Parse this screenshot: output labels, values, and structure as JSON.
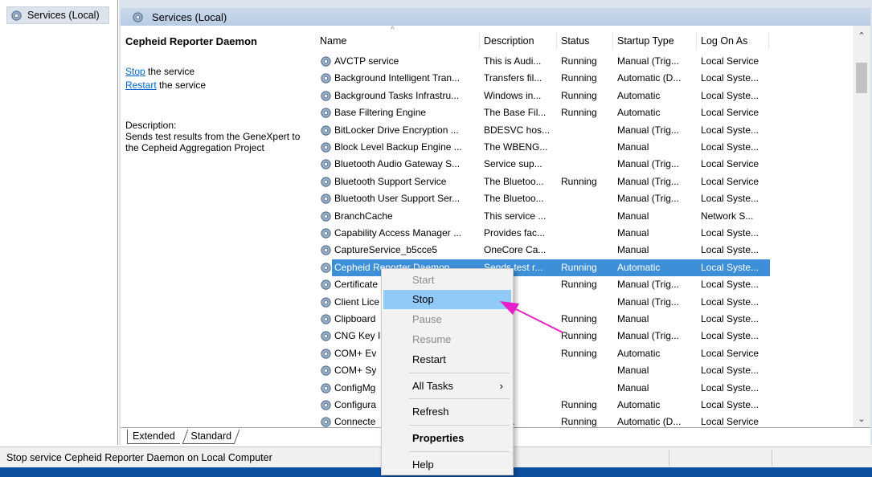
{
  "tree": {
    "root_label": "Services (Local)"
  },
  "header": {
    "title": "Services (Local)"
  },
  "detail": {
    "service_name": "Cepheid Reporter Daemon",
    "stop_link": "Stop",
    "stop_suffix": " the service",
    "restart_link": "Restart",
    "restart_suffix": " the service",
    "description_heading": "Description:",
    "description": "Sends test results from the GeneXpert to the Cepheid Aggregation Project"
  },
  "columns": {
    "name": "Name",
    "description": "Description",
    "status": "Status",
    "startup_type": "Startup Type",
    "log_on_as": "Log On As"
  },
  "services": [
    {
      "name": "AVCTP service",
      "desc": "This is Audi...",
      "status": "Running",
      "type": "Manual (Trig...",
      "logon": "Local Service"
    },
    {
      "name": "Background Intelligent Tran...",
      "desc": "Transfers fil...",
      "status": "Running",
      "type": "Automatic (D...",
      "logon": "Local Syste..."
    },
    {
      "name": "Background Tasks Infrastru...",
      "desc": "Windows in...",
      "status": "Running",
      "type": "Automatic",
      "logon": "Local Syste..."
    },
    {
      "name": "Base Filtering Engine",
      "desc": "The Base Fil...",
      "status": "Running",
      "type": "Automatic",
      "logon": "Local Service"
    },
    {
      "name": "BitLocker Drive Encryption ...",
      "desc": "BDESVC hos...",
      "status": "",
      "type": "Manual (Trig...",
      "logon": "Local Syste..."
    },
    {
      "name": "Block Level Backup Engine ...",
      "desc": "The WBENG...",
      "status": "",
      "type": "Manual",
      "logon": "Local Syste..."
    },
    {
      "name": "Bluetooth Audio Gateway S...",
      "desc": "Service sup...",
      "status": "",
      "type": "Manual (Trig...",
      "logon": "Local Service"
    },
    {
      "name": "Bluetooth Support Service",
      "desc": "The Bluetoo...",
      "status": "Running",
      "type": "Manual (Trig...",
      "logon": "Local Service"
    },
    {
      "name": "Bluetooth User Support Ser...",
      "desc": "The Bluetoo...",
      "status": "",
      "type": "Manual (Trig...",
      "logon": "Local Syste..."
    },
    {
      "name": "BranchCache",
      "desc": "This service ...",
      "status": "",
      "type": "Manual",
      "logon": "Network S..."
    },
    {
      "name": "Capability Access Manager ...",
      "desc": "Provides fac...",
      "status": "",
      "type": "Manual",
      "logon": "Local Syste..."
    },
    {
      "name": "CaptureService_b5cce5",
      "desc": "OneCore Ca...",
      "status": "",
      "type": "Manual",
      "logon": "Local Syste..."
    },
    {
      "name": "Cepheid Reporter Daemon",
      "desc": "Sends test r...",
      "status": "Running",
      "type": "Automatic",
      "logon": "Local Syste..."
    },
    {
      "name": "Certificate",
      "desc": "user ...",
      "status": "Running",
      "type": "Manual (Trig...",
      "logon": "Local Syste..."
    },
    {
      "name": "Client Lice",
      "desc": "es inf...",
      "status": "",
      "type": "Manual (Trig...",
      "logon": "Local Syste..."
    },
    {
      "name": "Clipboard",
      "desc": "er se...",
      "status": "Running",
      "type": "Manual",
      "logon": "Local Syste..."
    },
    {
      "name": "CNG Key I",
      "desc": "G ke...",
      "status": "Running",
      "type": "Manual (Trig...",
      "logon": "Local Syste..."
    },
    {
      "name": "COM+ Ev",
      "desc": "ts Sy...",
      "status": "Running",
      "type": "Automatic",
      "logon": "Local Service"
    },
    {
      "name": "COM+ Sy",
      "desc": "es th...",
      "status": "",
      "type": "Manual",
      "logon": "Local Syste..."
    },
    {
      "name": "ConfigMg",
      "desc": "Mgr ...",
      "status": "",
      "type": "Manual",
      "logon": "Local Syste..."
    },
    {
      "name": "Configura",
      "desc": "es th...",
      "status": "Running",
      "type": "Automatic",
      "logon": "Local Syste..."
    },
    {
      "name": "Connecte",
      "desc": "rvice ...",
      "status": "Running",
      "type": "Automatic (D...",
      "logon": "Local Service"
    }
  ],
  "tabs": {
    "extended": "Extended",
    "standard": "Standard"
  },
  "status_bar": {
    "text": "Stop service Cepheid Reporter Daemon on Local Computer"
  },
  "context_menu": {
    "start": "Start",
    "stop": "Stop",
    "pause": "Pause",
    "resume": "Resume",
    "restart": "Restart",
    "all_tasks": "All Tasks",
    "refresh": "Refresh",
    "properties": "Properties",
    "help": "Help"
  },
  "colors": {
    "selection": "#3d8fd7",
    "menu_hover": "#91c9f7",
    "annotation_arrow": "#e81ec8",
    "link": "#0066cc"
  }
}
